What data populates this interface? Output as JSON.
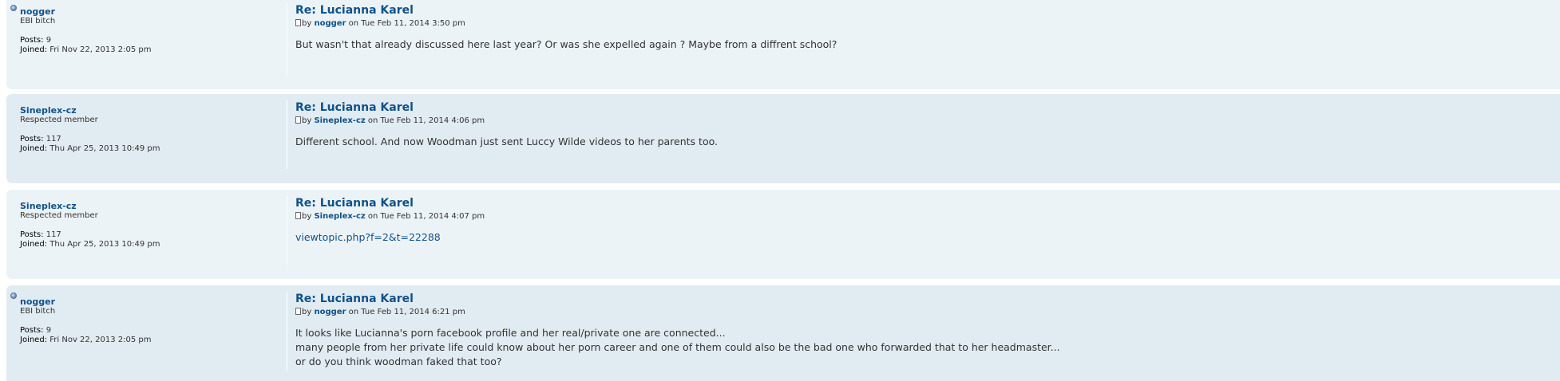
{
  "posts": [
    {
      "author": "nogger",
      "rank": "EBI bitch",
      "online": true,
      "posts_label": "Posts:",
      "posts_count": "9",
      "joined_label": "Joined:",
      "joined": "Fri Nov 22, 2013 2:05 pm",
      "title": "Re: Lucianna Karel",
      "by": "by",
      "on_date": "on Tue Feb 11, 2014 3:50 pm",
      "content": [
        "But wasn't that already discussed here last year? Or was she expelled again ? Maybe from a diffrent school?"
      ]
    },
    {
      "author": "Sineplex-cz",
      "rank": "Respected member",
      "online": false,
      "posts_label": "Posts:",
      "posts_count": "117",
      "joined_label": "Joined:",
      "joined": "Thu Apr 25, 2013 10:49 pm",
      "title": "Re: Lucianna Karel",
      "by": "by",
      "on_date": "on Tue Feb 11, 2014 4:06 pm",
      "content": [
        "Different school. And now Woodman just sent Luccy Wilde videos to her parents too."
      ]
    },
    {
      "author": "Sineplex-cz",
      "rank": "Respected member",
      "online": false,
      "posts_label": "Posts:",
      "posts_count": "117",
      "joined_label": "Joined:",
      "joined": "Thu Apr 25, 2013 10:49 pm",
      "title": "Re: Lucianna Karel",
      "by": "by",
      "on_date": "on Tue Feb 11, 2014 4:07 pm",
      "link": "viewtopic.php?f=2&t=22288"
    },
    {
      "author": "nogger",
      "rank": "EBI bitch",
      "online": true,
      "posts_label": "Posts:",
      "posts_count": "9",
      "joined_label": "Joined:",
      "joined": "Fri Nov 22, 2013 2:05 pm",
      "title": "Re: Lucianna Karel",
      "by": "by",
      "on_date": "on Tue Feb 11, 2014 6:21 pm",
      "content": [
        "It looks like Lucianna's porn facebook profile and her real/private one are connected...",
        "many people from her private life could know about her porn career and one of them could also be the bad one who forwarded that to her headmaster...",
        "or do you think woodman faked that too?"
      ]
    }
  ]
}
